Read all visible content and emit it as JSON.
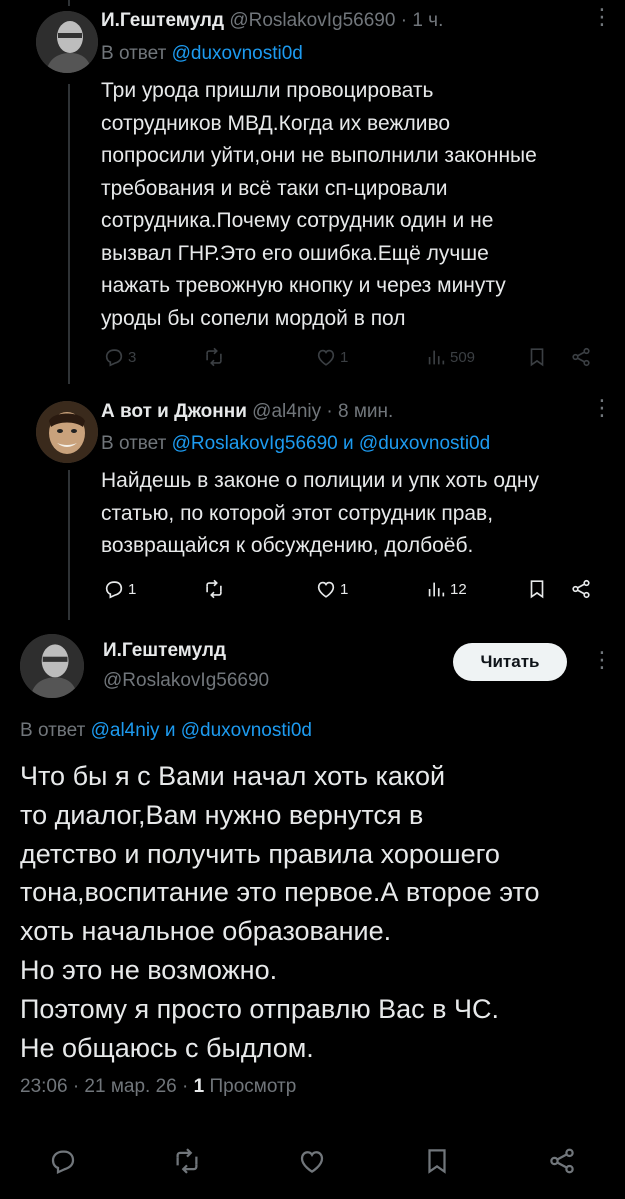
{
  "tweets": [
    {
      "name": "И.Гештемулд",
      "handle": "@RoslakovIg56690",
      "time": "· 1 ч.",
      "reply_prefix": "В ответ",
      "reply_to": "@duxovnosti0d",
      "text_lines": [
        "Три урода пришли провоцировать",
        "сотрудников МВД.Когда их вежливо",
        "попросили уйти,они не выполнили законные",
        "требования и всё таки сп-цировали",
        "сотрудника.Почему сотрудник один и не",
        "вызвал ГНР.Это его ошибка.Ещё лучше",
        "нажать тревожную кнопку и через минуту",
        "уроды бы сопели мордой в пол"
      ],
      "replies": "3",
      "retweets": "",
      "likes": "1",
      "views": "509"
    },
    {
      "name": "А вот и Джонни",
      "handle": "@al4niy",
      "time": "· 8 мин.",
      "reply_prefix": "В ответ",
      "reply_to": "@RoslakovIg56690",
      "reply_and": "и",
      "reply_to_2": "@duxovnosti0d",
      "text_lines": [
        "Найдешь в законе о полиции и упк хоть одну",
        "статью, по которой этот сотрудник прав,",
        "возвращайся к обсуждению, долбоёб."
      ],
      "replies": "1",
      "retweets": "",
      "likes": "1",
      "views": "12"
    }
  ],
  "main_tweet": {
    "name": "И.Гештемулд",
    "handle": "@RoslakovIg56690",
    "follow_label": "Читать",
    "reply_prefix": "В ответ",
    "reply_to": "@al4niy",
    "reply_and": "и",
    "reply_to_2": "@duxovnosti0d",
    "text_lines": [
      "Что бы я с Вами начал хоть какой",
      "то диалог,Вам нужно вернутся в",
      "детство и получить правила хорошего",
      "тона,воспитание это первое.А второе это",
      "хоть начальное образование.",
      "Но это не возможно.",
      "Поэтому я просто отправлю Вас в ЧС.",
      "Не общаюсь с быдлом."
    ],
    "time": "23:06 · 21 мар. 26 ·",
    "views_count": "1",
    "views_label": "Просмотр"
  },
  "icons": {
    "reply": "reply-icon",
    "retweet": "retweet-icon",
    "like": "heart-icon",
    "views": "views-icon",
    "bookmark": "bookmark-icon",
    "share": "share-icon",
    "more": "more-icon"
  },
  "colors": {
    "background": "#000000",
    "text": "#e7e9ea",
    "muted": "#71767b",
    "link": "#1d9bf0",
    "follow_bg": "#eff3f4"
  }
}
